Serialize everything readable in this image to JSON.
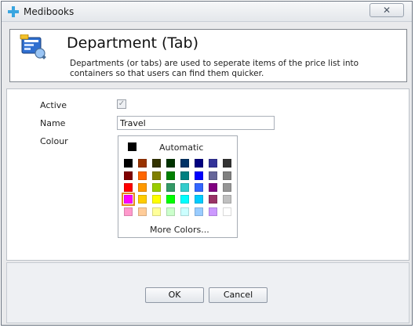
{
  "window": {
    "title": "Medibooks",
    "close_icon": "close-icon"
  },
  "header": {
    "title": "Department (Tab)",
    "description": "Departments (or tabs) are used to seperate items of the price list into containers so that users can find them quicker.",
    "icon": "department-icon"
  },
  "form": {
    "active_label": "Active",
    "active_checked": true,
    "name_label": "Name",
    "name_value": "Travel",
    "colour_label": "Colour"
  },
  "palette": {
    "automatic_label": "Automatic",
    "automatic_color": "#000000",
    "more_colors_label": "More Colors...",
    "selected_color": "#ff00ff",
    "rows": [
      [
        "#000000",
        "#993300",
        "#333300",
        "#003300",
        "#003366",
        "#000080",
        "#333399",
        "#333333"
      ],
      [
        "#800000",
        "#ff6600",
        "#808000",
        "#008000",
        "#008080",
        "#0000ff",
        "#666699",
        "#808080"
      ],
      [
        "#ff0000",
        "#ff9900",
        "#99cc00",
        "#339966",
        "#33cccc",
        "#3366ff",
        "#800080",
        "#969696"
      ],
      [
        "#ff00ff",
        "#ffcc00",
        "#ffff00",
        "#00ff00",
        "#00ffff",
        "#00ccff",
        "#993366",
        "#c0c0c0"
      ],
      [
        "#ff99cc",
        "#ffcc99",
        "#ffff99",
        "#ccffcc",
        "#ccffff",
        "#99ccff",
        "#cc99ff",
        "#ffffff"
      ]
    ]
  },
  "buttons": {
    "ok": "OK",
    "cancel": "Cancel"
  }
}
